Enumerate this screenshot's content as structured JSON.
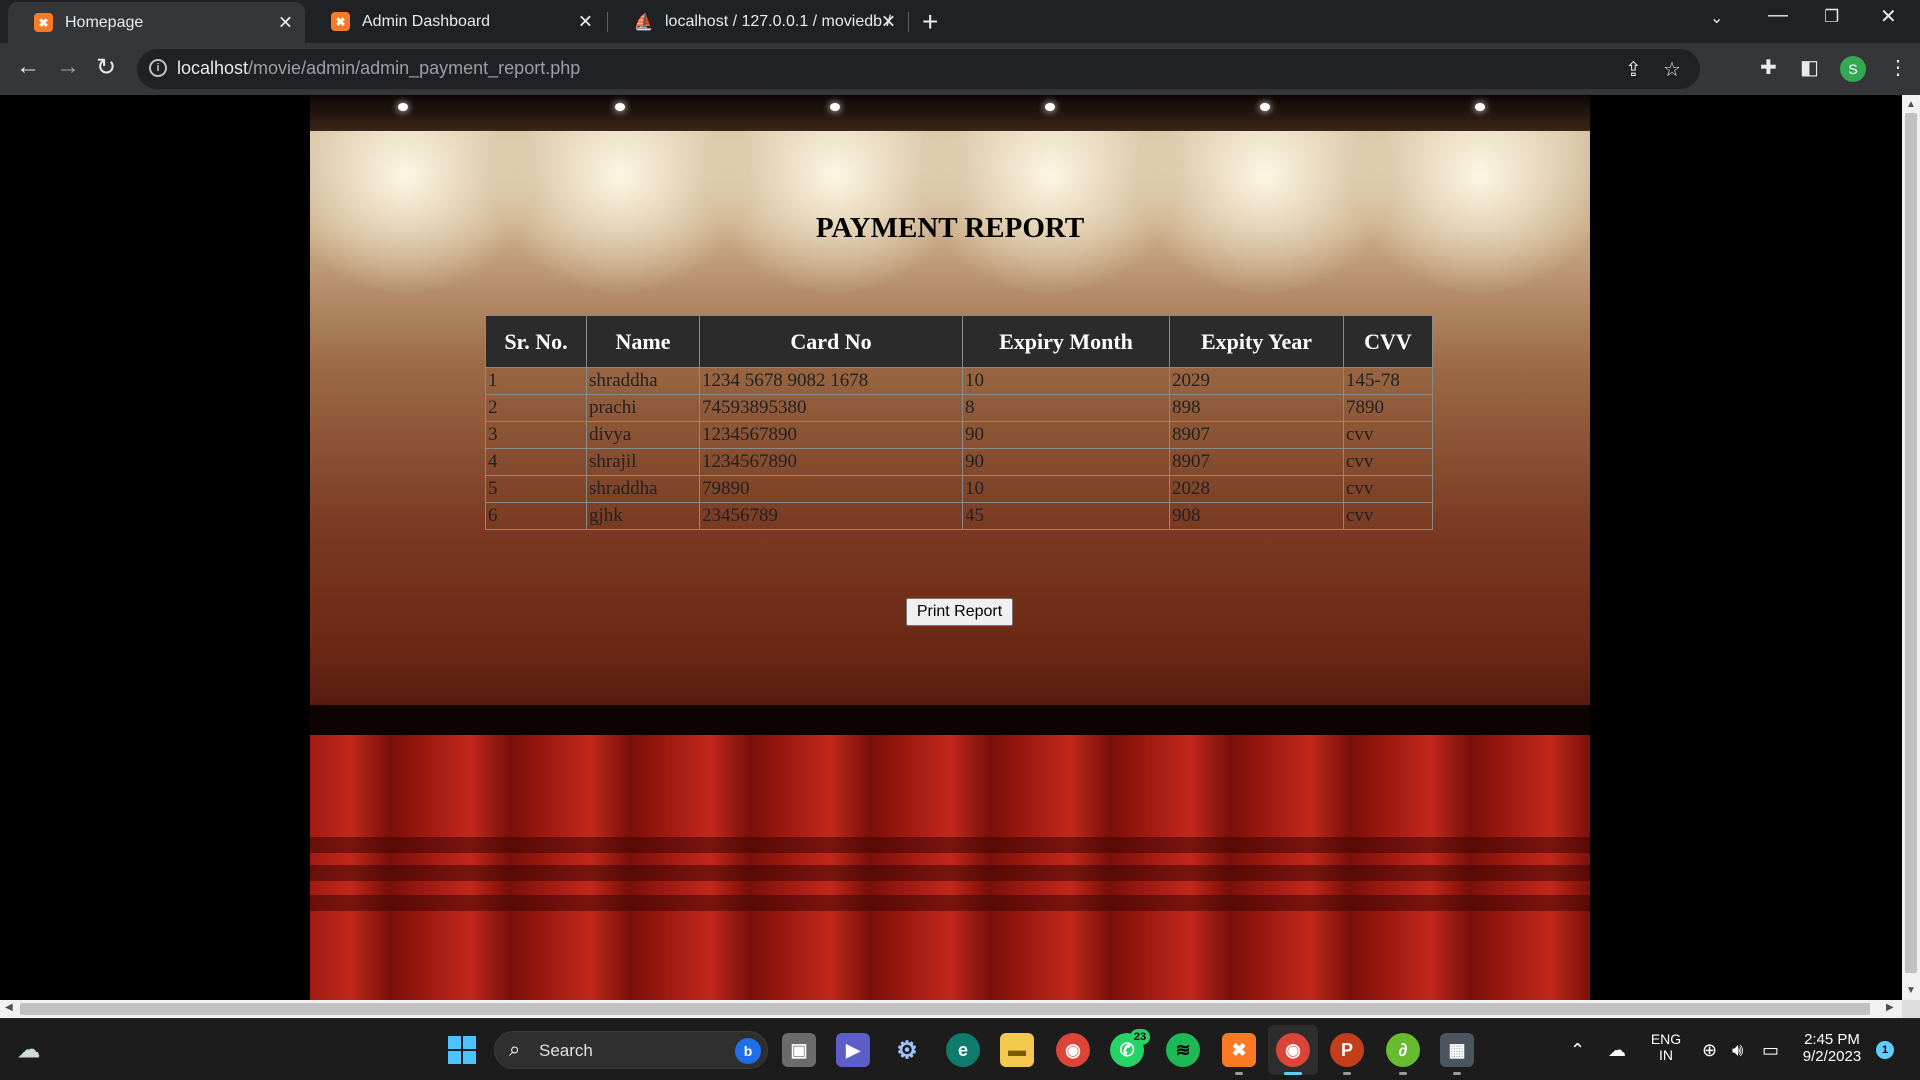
{
  "browser": {
    "tabs": [
      {
        "title": "Homepage",
        "icon": "xampp-icon",
        "active": true
      },
      {
        "title": "Admin Dashboard",
        "icon": "xampp-icon",
        "active": false
      },
      {
        "title": "localhost / 127.0.0.1 / moviedb /",
        "icon": "phpmyadmin-icon",
        "active": false
      }
    ],
    "url_host": "localhost",
    "url_path": "/movie/admin/admin_payment_report.php",
    "profile_initial": "S"
  },
  "page": {
    "title": "PAYMENT REPORT",
    "table": {
      "headers": [
        "Sr. No.",
        "Name",
        "Card No",
        "Expiry Month",
        "Expity Year",
        "CVV"
      ],
      "rows": [
        [
          "1",
          "shraddha",
          "1234 5678 9082 1678",
          "10",
          "2029",
          "145-78"
        ],
        [
          "2",
          "prachi",
          "74593895380",
          "8",
          "898",
          "7890"
        ],
        [
          "3",
          "divya",
          "1234567890",
          "90",
          "8907",
          "cvv"
        ],
        [
          "4",
          "shrajil",
          "1234567890",
          "90",
          "8907",
          "cvv"
        ],
        [
          "5",
          "shraddha",
          "79890",
          "10",
          "2028",
          "cvv"
        ],
        [
          "6",
          "gjhk",
          "23456789",
          "45",
          "908",
          "cvv"
        ]
      ]
    },
    "print_button": "Print Report"
  },
  "taskbar": {
    "search_placeholder": "Search",
    "whatsapp_badge": "23",
    "language_line1": "ENG",
    "language_line2": "IN",
    "time": "2:45 PM",
    "date": "9/2/2023",
    "notification_count": "1"
  },
  "colors": {
    "browser_dark": "#202124",
    "toolbar": "#35363a",
    "table_header": "#2b2b2b",
    "taskbar": "#1c1c1c",
    "accent": "#60cdff"
  }
}
